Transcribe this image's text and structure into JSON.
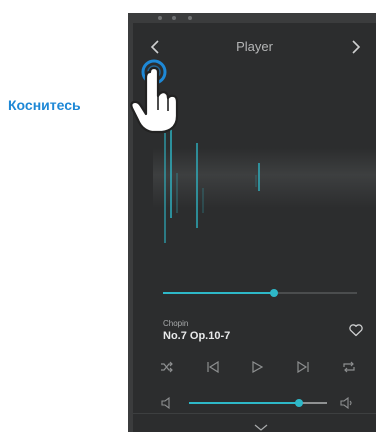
{
  "screen": {
    "title": "Player",
    "nav": {
      "back_icon": "chevron-left-icon",
      "next_icon": "chevron-right-icon"
    }
  },
  "track": {
    "artist": "Chopin",
    "title": "No.7 Op.10-7",
    "progress": 0.57
  },
  "controls": {
    "buttons": [
      "shuffle-icon",
      "previous-icon",
      "play-icon",
      "next-icon",
      "repeat-icon"
    ],
    "like_icon": "heart-icon"
  },
  "volume": {
    "level": 0.8,
    "min_icon": "volume-low-icon",
    "max_icon": "volume-high-icon"
  },
  "bottom": {
    "collapse_icon": "chevron-down-icon"
  },
  "hint": {
    "label": "Коснитесь",
    "gesture_icon": "tap-hand-icon"
  },
  "colors": {
    "accent": "#2eb8c8",
    "background": "#2c2d2e",
    "hint": "#1e88d6"
  }
}
